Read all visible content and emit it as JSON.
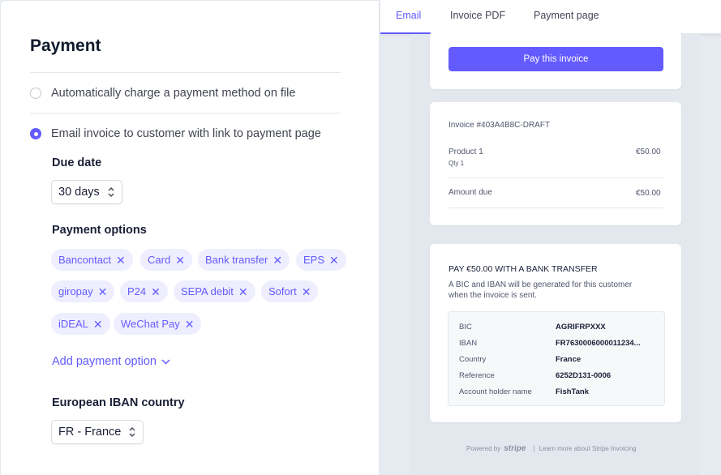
{
  "payment": {
    "title": "Payment",
    "option_auto": "Automatically charge a payment method on file",
    "option_email": "Email invoice to customer with link to payment page",
    "due_date_label": "Due date",
    "due_date_value": "30 days",
    "payment_options_label": "Payment options",
    "chips": [
      "Bancontact",
      "Card",
      "Bank transfer",
      "EPS",
      "giropay",
      "P24",
      "SEPA debit",
      "Sofort",
      "iDEAL",
      "WeChat Pay"
    ],
    "add_option": "Add payment option",
    "iban_label": "European IBAN country",
    "iban_value": "FR - France"
  },
  "tabs": [
    "Email",
    "Invoice PDF",
    "Payment page"
  ],
  "preview": {
    "pay_button": "Pay this invoice",
    "invoice_number": "Invoice #403A4B8C-DRAFT",
    "product": "Product 1",
    "product_price": "€50.00",
    "qty": "Qty 1",
    "amount_due_label": "Amount due",
    "amount_due": "€50.00",
    "bank_title": "PAY €50.00 WITH A BANK TRANSFER",
    "bank_desc_1": "A BIC and IBAN will be generated for this customer",
    "bank_desc_2": "when the invoice is sent.",
    "fields": [
      {
        "k": "BIC",
        "v": "AGRIFRPXXX"
      },
      {
        "k": "IBAN",
        "v": "FR7630006000011234..."
      },
      {
        "k": "Country",
        "v": "France"
      },
      {
        "k": "Reference",
        "v": "6252D131-0006"
      },
      {
        "k": "Account holder name",
        "v": "FishTank"
      }
    ],
    "footer_powered": "Powered by",
    "footer_brand": "stripe",
    "footer_sep": "|",
    "footer_learn": "Learn more about Stripe Invoicing"
  },
  "colors": {
    "accent": "#635bff",
    "chip_bg": "#eeeefe",
    "preview_bg": "#e3e8ee"
  }
}
